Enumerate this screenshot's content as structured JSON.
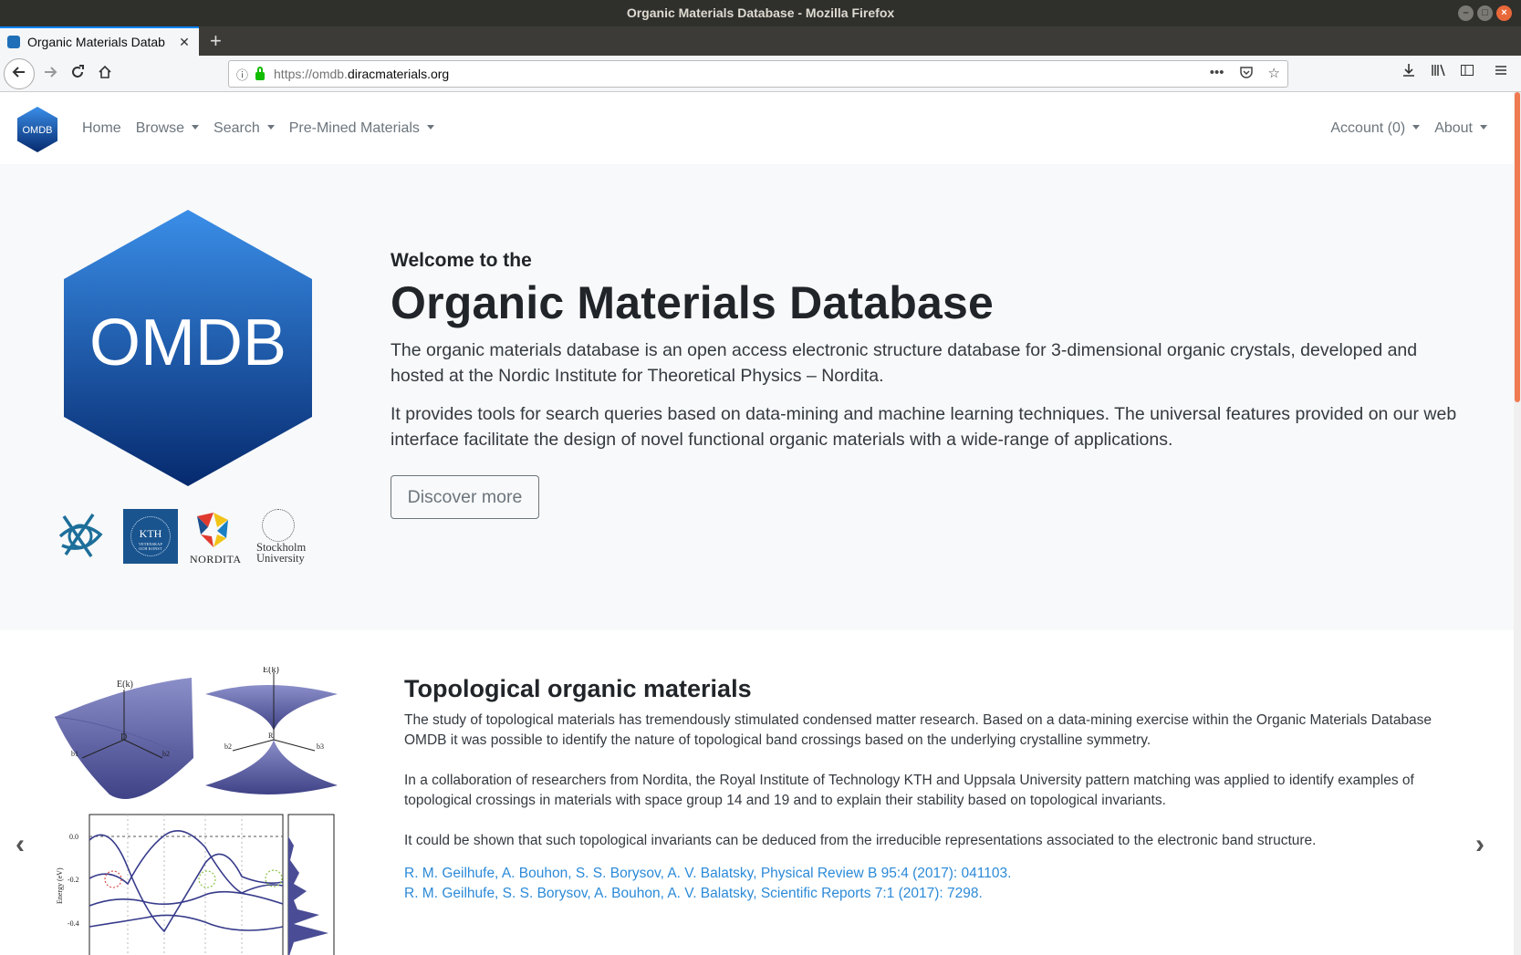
{
  "window": {
    "title": "Organic Materials Database - Mozilla Firefox"
  },
  "tab": {
    "title": "Organic Materials Datab",
    "close": "✕",
    "new_tab": "+"
  },
  "browser": {
    "url_prefix": "https://omdb.",
    "url_host": "diracmaterials.org",
    "page_actions": "•••"
  },
  "site": {
    "brand": "OMDB",
    "nav": {
      "home": "Home",
      "browse": "Browse",
      "search": "Search",
      "premined": "Pre-Mined Materials"
    },
    "nav_right": {
      "account": "Account (0)",
      "about": "About"
    }
  },
  "hero": {
    "logo_text": "OMDB",
    "welcome": "Welcome to the",
    "title": "Organic Materials Database",
    "p1": "The organic materials database is an open access electronic structure database for 3-dimensional organic crystals, developed and hosted at the Nordic Institute for Theoretical Physics – Nordita.",
    "p2": "It provides tools for search queries based on data-mining and machine learning techniques. The universal features provided on our web interface facilitate the design of novel functional organic materials with a wide-range of applications.",
    "button": "Discover more",
    "logos": {
      "kth": "KTH",
      "kth_sub1": "VETENSKAP",
      "kth_sub2": "OCH KONST",
      "nordita": "NORDITA",
      "su_line1": "Stockholm",
      "su_line2": "University"
    }
  },
  "carousel": {
    "title": "Topological organic materials",
    "p1": "The study of topological materials has tremendously stimulated condensed matter research. Based on a data-mining exercise within the Organic Materials Database OMDB it was possible to identify the nature of topological band crossings based on the underlying crystalline symmetry.",
    "p2": "In a collaboration of researchers from Nordita, the Royal Institute of Technology KTH and Uppsala University pattern matching was applied to identify examples of topological crossings in materials with space group 14 and 19 and to explain their stability based on topological invariants.",
    "p3": "It could be shown that such topological invariants can be deduced from the irreducible representations associated to the electronic band structure.",
    "ref1": "R. M. Geilhufe, A. Bouhon, S. S. Borysov, A. V. Balatsky, Physical Review B 95:4 (2017): 041103.",
    "ref2": "R. M. Geilhufe, S. S. Borysov, A. Bouhon, A. V. Balatsky, Scientific Reports 7:1 (2017): 7298.",
    "prev": "‹",
    "next": "›",
    "figure": {
      "ek1": "E(k)",
      "ek2": "E(k)",
      "d": "D",
      "r": "R",
      "b1": "b1",
      "b2": "b2",
      "b3": "b3",
      "b4": "b2",
      "b5": "b3",
      "y0": "0.0",
      "y1": "-0.2",
      "y2": "-0.4",
      "ylabel": "Energy (eV)"
    }
  },
  "colors": {
    "brand_top": "#3a8ee8",
    "brand_bottom": "#062a6e",
    "link": "#2b8ad8",
    "tab_accent": "#0a84ff"
  }
}
